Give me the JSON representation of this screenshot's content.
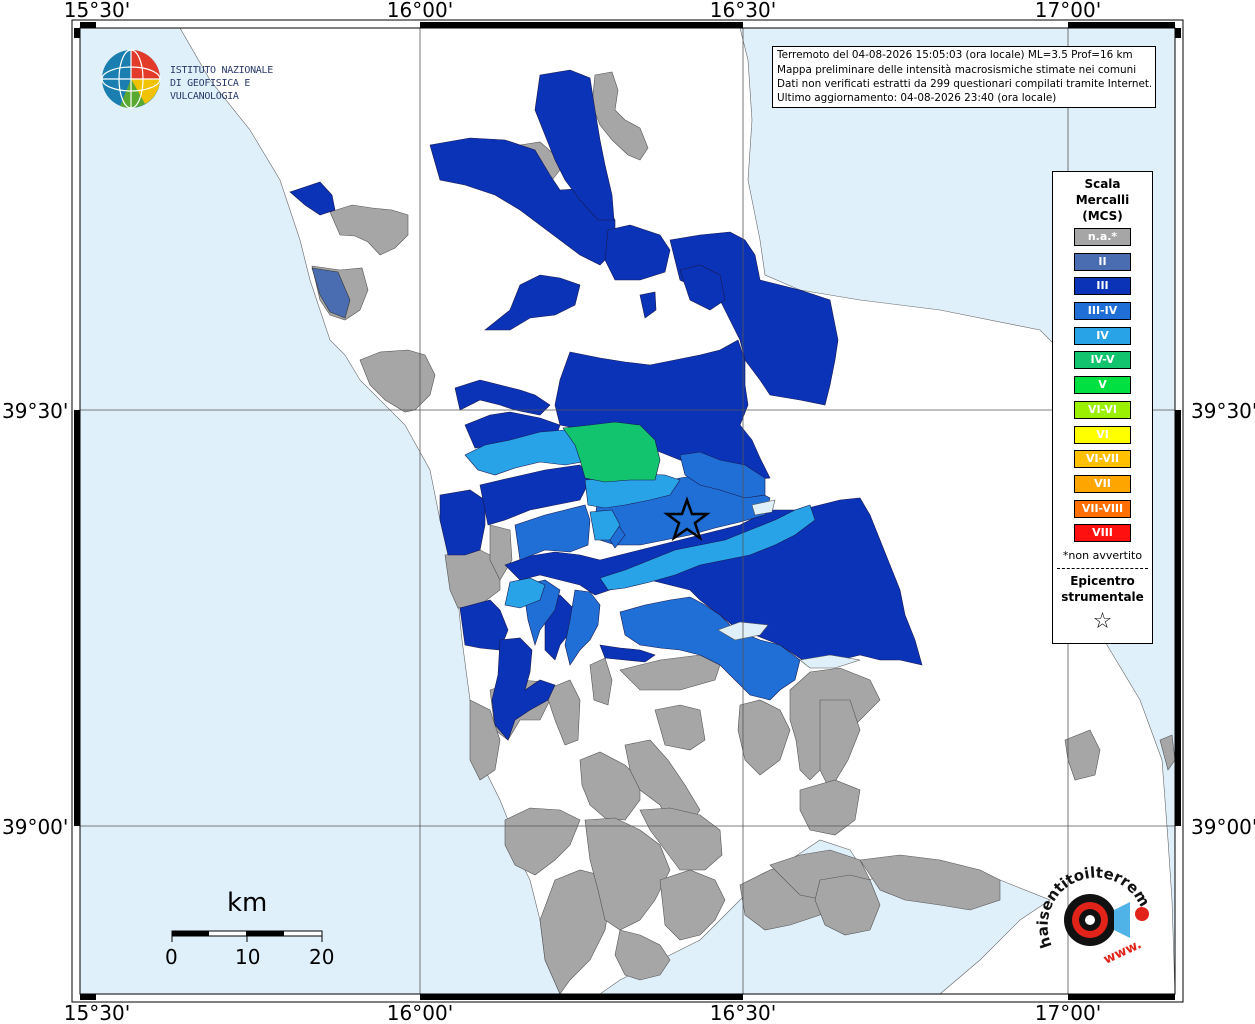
{
  "map": {
    "coords": {
      "top": [
        "15°30'",
        "16°00'",
        "16°30'",
        "17°00'"
      ],
      "bottom": [
        "15°30'",
        "16°00'",
        "16°30'",
        "17°00'"
      ],
      "left": [
        "39°30'",
        "39°00'"
      ],
      "right": [
        "39°30'",
        "39°00'"
      ]
    },
    "colors": {
      "sea": "#dff0fb",
      "land": "#ffffff",
      "na": "#a6a6a6",
      "II": "#4a6db2",
      "III": "#0a33b8",
      "III_IV": "#1f6fd6",
      "IV": "#29a3e8",
      "IV_V": "#13c46e",
      "epicenter": "#000000"
    }
  },
  "logo": {
    "line1": "ISTITUTO NAZIONALE",
    "line2": "DI GEOFISICA E VULCANOLOGIA"
  },
  "info": {
    "line1": "Terremoto del 04-08-2026 15:05:03 (ora locale) ML=3.5 Prof=16 km",
    "line2": "Mappa preliminare delle intensità macrosismiche stimate nei comuni",
    "line3": "Dati non verificati estratti da 299 questionari compilati tramite Internet.",
    "line4": "Ultimo aggiornamento: 04-08-2026 23:40 (ora locale)"
  },
  "legend": {
    "title1": "Scala",
    "title2": "Mercalli",
    "title3": "(MCS)",
    "items": [
      {
        "label": "n.a.*",
        "color": "#a6a6a6"
      },
      {
        "label": "II",
        "color": "#4a6db2"
      },
      {
        "label": "III",
        "color": "#0a33b8"
      },
      {
        "label": "III-IV",
        "color": "#1f6fd6"
      },
      {
        "label": "IV",
        "color": "#29a3e8"
      },
      {
        "label": "IV-V",
        "color": "#13c46e"
      },
      {
        "label": "V",
        "color": "#00e040"
      },
      {
        "label": "VI-VI",
        "color": "#9af000"
      },
      {
        "label": "VI",
        "color": "#ffff00"
      },
      {
        "label": "VI-VII",
        "color": "#ffc000"
      },
      {
        "label": "VII",
        "color": "#ffa500"
      },
      {
        "label": "VII-VIII",
        "color": "#ff7000"
      },
      {
        "label": "VIII",
        "color": "#ff1010"
      }
    ],
    "note": "*non avvertito",
    "epi1": "Epicentro",
    "epi2": "strumentale",
    "star": "☆"
  },
  "scale": {
    "title": "km",
    "labels": [
      "0",
      "10",
      "20"
    ]
  },
  "hai": {
    "text": "haisentitoilterremoto.it",
    "www": "www."
  }
}
